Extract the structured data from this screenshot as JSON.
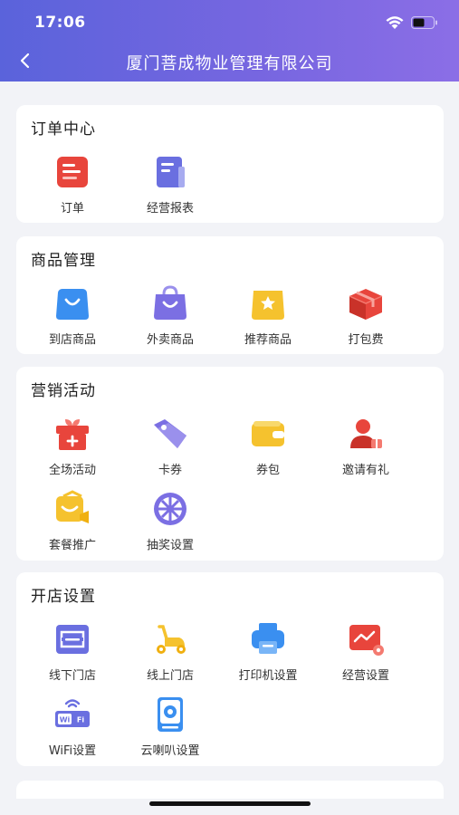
{
  "status_bar": {
    "time": "17:06"
  },
  "nav": {
    "title": "厦门菩成物业管理有限公司",
    "back_icon": "chevron-left-icon"
  },
  "sections": [
    {
      "title": "订单中心",
      "items": [
        {
          "label": "订单",
          "icon": "order-icon",
          "color": "#e8453c"
        },
        {
          "label": "经营报表",
          "icon": "report-icon",
          "color": "#6a6fe0"
        }
      ]
    },
    {
      "title": "商品管理",
      "items": [
        {
          "label": "到店商品",
          "icon": "store-bag-icon",
          "color": "#3a8ff0"
        },
        {
          "label": "外卖商品",
          "icon": "takeout-bag-icon",
          "color": "#7b6fe3"
        },
        {
          "label": "推荐商品",
          "icon": "star-bag-icon",
          "color": "#f5c22e"
        },
        {
          "label": "打包费",
          "icon": "package-icon",
          "color": "#e8453c"
        }
      ]
    },
    {
      "title": "营销活动",
      "items": [
        {
          "label": "全场活动",
          "icon": "gift-icon",
          "color": "#e8453c"
        },
        {
          "label": "卡券",
          "icon": "tag-icon",
          "color": "#7b6fe3"
        },
        {
          "label": "券包",
          "icon": "wallet-icon",
          "color": "#f5c22e"
        },
        {
          "label": "邀请有礼",
          "icon": "invite-user-icon",
          "color": "#e8453c"
        },
        {
          "label": "套餐推广",
          "icon": "package-promo-icon",
          "color": "#f5c22e"
        },
        {
          "label": "抽奖设置",
          "icon": "lottery-wheel-icon",
          "color": "#7b6fe3"
        }
      ]
    },
    {
      "title": "开店设置",
      "items": [
        {
          "label": "线下门店",
          "icon": "offline-store-icon",
          "color": "#6a6fe0"
        },
        {
          "label": "线上门店",
          "icon": "scooter-icon",
          "color": "#f5c22e"
        },
        {
          "label": "打印机设置",
          "icon": "printer-icon",
          "color": "#3a8ff0"
        },
        {
          "label": "经营设置",
          "icon": "business-settings-icon",
          "color": "#e8453c"
        },
        {
          "label": "WiFi设置",
          "icon": "wifi-settings-icon",
          "color": "#6a6fe0"
        },
        {
          "label": "云喇叭设置",
          "icon": "speaker-icon",
          "color": "#3a8ff0"
        }
      ]
    }
  ]
}
